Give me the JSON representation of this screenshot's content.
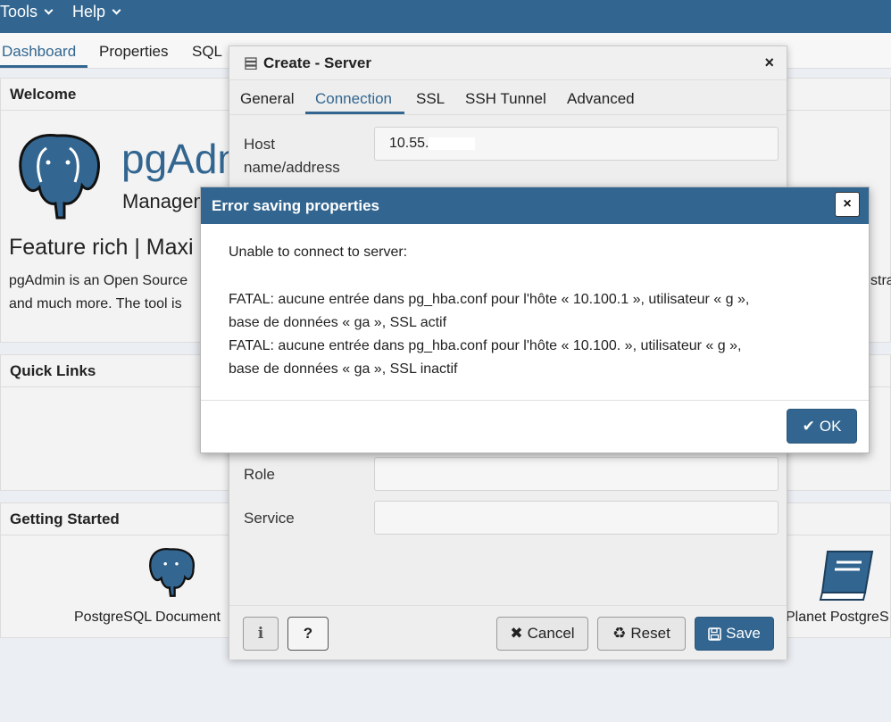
{
  "topbar": {
    "tools": "Tools",
    "help": "Help"
  },
  "tabs": {
    "dashboard": "Dashboard",
    "properties": "Properties",
    "sql": "SQL"
  },
  "dashboard": {
    "welcome_title": "Welcome",
    "logo_text": "pgAdm",
    "logo_sub": "Managem",
    "feature": "Feature rich | Maxi",
    "desc_line1": "pgAdmin is an Open Source",
    "desc_line2": "and much more. The tool is",
    "desc_right": "stra",
    "quick_links": "Quick Links",
    "getting_started": "Getting Started",
    "gs_left": "PostgreSQL Document",
    "gs_right": "Planet PostgreS"
  },
  "create_dialog": {
    "title": "Create - Server",
    "close": "×",
    "tabs": [
      "General",
      "Connection",
      "SSL",
      "SSH Tunnel",
      "Advanced"
    ],
    "host_label_1": "Host",
    "host_label_2": "name/address",
    "host_value": "10.55.",
    "role_label": "Role",
    "service_label": "Service",
    "cancel": "Cancel",
    "reset": "Reset",
    "save": "Save",
    "info": "i",
    "help": "?"
  },
  "error_dialog": {
    "title": "Error saving properties",
    "close": "×",
    "line0": "Unable to connect to server:",
    "line1": "FATAL: aucune entrée dans pg_hba.conf pour l'hôte « 10.100.1          », utilisateur « g       »,",
    "line2": "base de données « ga          », SSL actif",
    "line3": "FATAL: aucune entrée dans pg_hba.conf pour l'hôte « 10.100.          », utilisateur « g       »,",
    "line4": "base de données « ga          », SSL inactif",
    "ok": "OK"
  }
}
